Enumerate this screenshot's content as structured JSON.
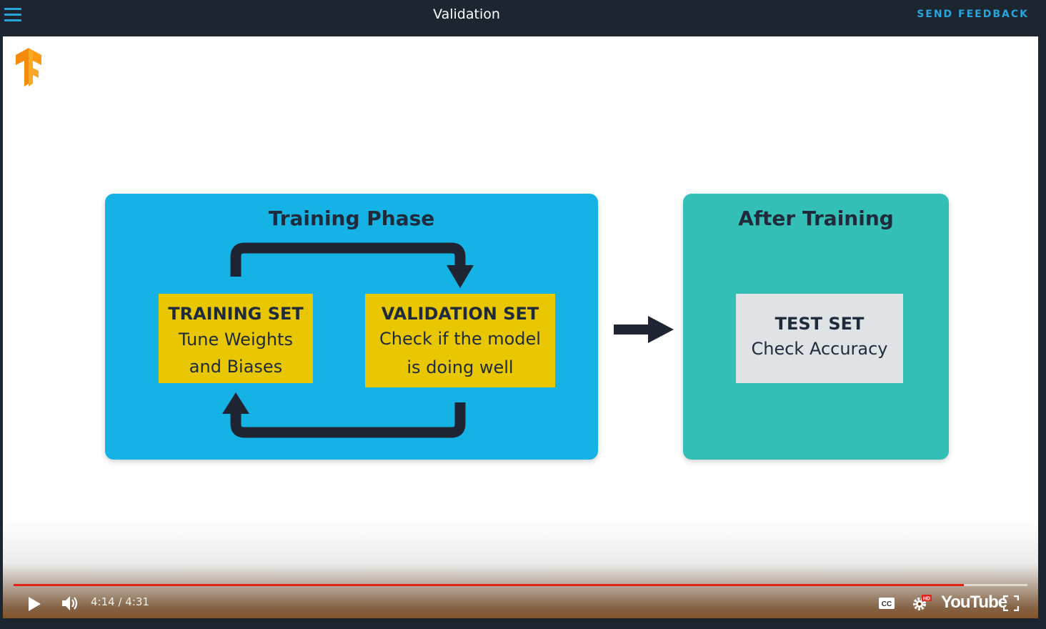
{
  "header": {
    "title": "Validation",
    "feedback_label": "SEND FEEDBACK",
    "accent_color": "#2aa4dc"
  },
  "slide": {
    "training_phase": {
      "title": "Training Phase",
      "color": "#14b2e5",
      "training_set": {
        "head": "TRAINING SET",
        "line1": "Tune Weights",
        "line2": "and Biases"
      },
      "validation_set": {
        "head": "VALIDATION SET",
        "line1": "Check if the model",
        "line2": "is doing well"
      }
    },
    "after_training": {
      "title": "After Training",
      "color": "#33bfb5",
      "test_set": {
        "head": "TEST SET",
        "line1": "Check Accuracy"
      }
    },
    "box_color": "#e8c600",
    "test_box_color": "#dfe3e6"
  },
  "player": {
    "current_time": "4:14",
    "duration": "4:31",
    "time_display": "4:14 / 4:31",
    "progress_fraction": 0.937,
    "progress_color": "#e62117",
    "brand": "YouTube",
    "icons": [
      "play-icon",
      "volume-icon",
      "captions-icon",
      "settings-icon",
      "hd-badge",
      "fullscreen-icon"
    ]
  }
}
